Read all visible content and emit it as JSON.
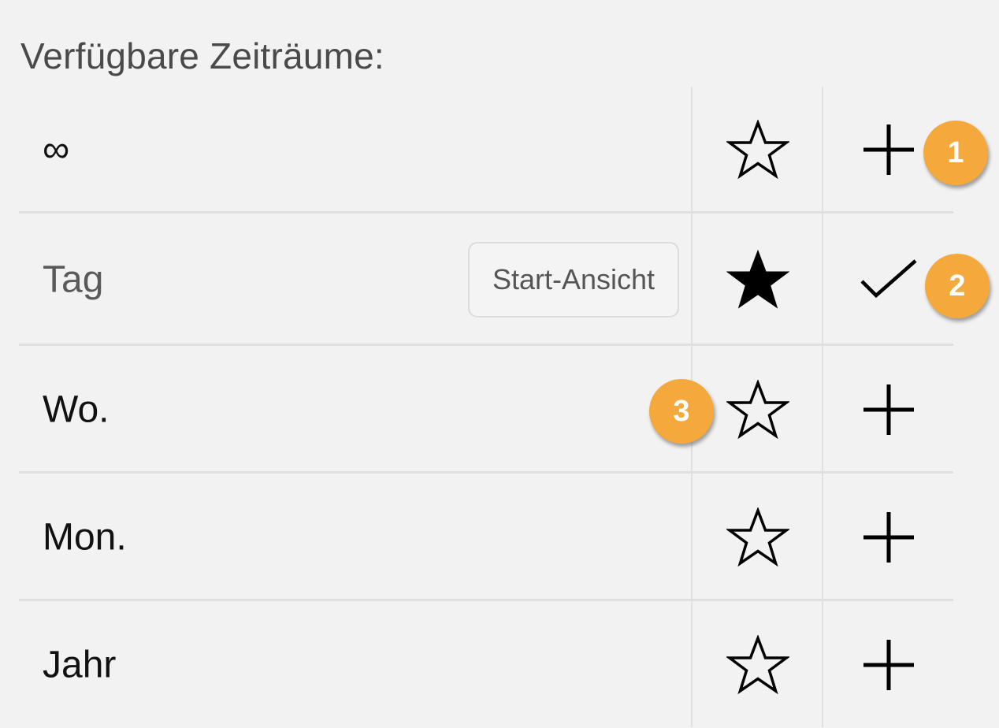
{
  "heading": "Verfügbare Zeiträume:",
  "rows": [
    {
      "label": "∞",
      "badge": "",
      "favorite": false,
      "action": "plus-icon"
    },
    {
      "label": "Tag",
      "badge": "Start-Ansicht",
      "favorite": true,
      "action": "check-icon"
    },
    {
      "label": "Wo.",
      "badge": "",
      "favorite": false,
      "action": "plus-icon"
    },
    {
      "label": "Mon.",
      "badge": "",
      "favorite": false,
      "action": "plus-icon"
    },
    {
      "label": "Jahr",
      "badge": "",
      "favorite": false,
      "action": "plus-icon"
    }
  ],
  "markers": [
    "1",
    "2",
    "3"
  ],
  "colors": {
    "background": "#f2f2f2",
    "divider": "#e0e0e0",
    "marker": "#f5a83c",
    "heading": "#4a4a4a"
  }
}
